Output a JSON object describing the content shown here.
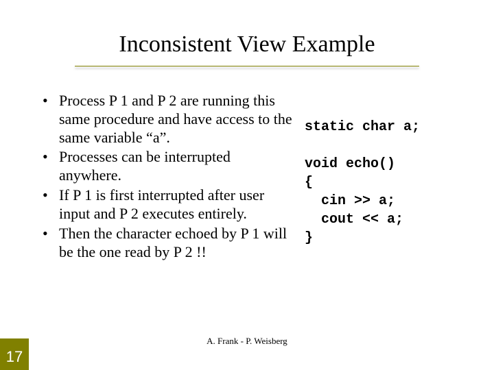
{
  "title": "Inconsistent View Example",
  "bullets": [
    "Process P 1 and P 2 are running this same procedure and have access to the same variable “a”.",
    "Processes can be interrupted anywhere.",
    "If P 1 is first interrupted after user input and P 2 executes entirely.",
    "Then the character echoed by P 1 will be the one read by P 2 !!"
  ],
  "code": {
    "line1": "static char a;",
    "line2": "",
    "line3": "void echo()",
    "line4": "{",
    "line5": "  cin >> a;",
    "line6": "  cout << a;",
    "line7": "}"
  },
  "footer_author": "A. Frank - P. Weisberg",
  "slide_number": "17",
  "colors": {
    "accent": "#808000"
  }
}
